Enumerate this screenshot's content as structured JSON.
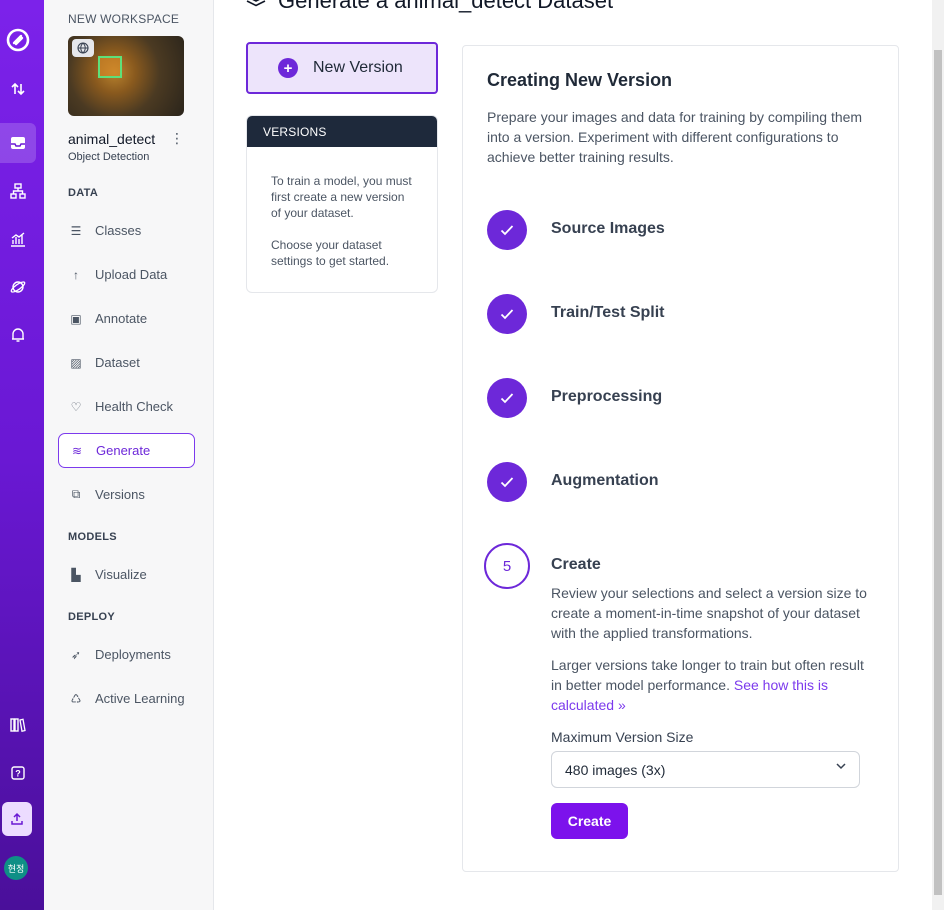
{
  "rail": {
    "icons": [
      "logo-icon",
      "swap-icon",
      "inbox-icon",
      "hierarchy-icon",
      "analytics-icon",
      "planet-icon",
      "bell-icon",
      "books-icon",
      "help-icon",
      "upload-icon"
    ],
    "avatar_text": "현정"
  },
  "sidebar": {
    "workspace_label": "NEW WORKSPACE",
    "project_name": "animal_detect",
    "project_type": "Object Detection",
    "sections": {
      "data": "DATA",
      "models": "MODELS",
      "deploy": "DEPLOY"
    },
    "items": {
      "classes": "Classes",
      "upload": "Upload Data",
      "annotate": "Annotate",
      "dataset": "Dataset",
      "health": "Health Check",
      "generate": "Generate",
      "versions": "Versions",
      "visualize": "Visualize",
      "deployments": "Deployments",
      "active_learning": "Active Learning"
    }
  },
  "header": {
    "title": "Generate a animal_detect Dataset"
  },
  "left_panel": {
    "new_version_label": "New Version",
    "versions_header": "VERSIONS",
    "versions_text_1": "To train a model, you must first create a new version of your dataset.",
    "versions_text_2": "Choose your dataset settings to get started."
  },
  "card": {
    "title": "Creating New Version",
    "description": "Prepare your images and data for training by compiling them into a version. Experiment with different configurations to achieve better training results.",
    "steps": {
      "s1": "Source Images",
      "s2": "Train/Test Split",
      "s3": "Preprocessing",
      "s4": "Augmentation",
      "s5": "Create",
      "s5_number": "5"
    },
    "create_text_1": "Review your selections and select a version size to create a moment-in-time snapshot of your dataset with the applied transformations.",
    "create_text_2": "Larger versions take longer to train but often result in better model performance.",
    "see_how_link": "See how this is calculated",
    "size_label": "Maximum Version Size",
    "size_value": "480 images (3x)",
    "create_button": "Create"
  },
  "colors": {
    "accent": "#6d28d9",
    "rail_top": "#7c22ea",
    "rail_bottom": "#4a0f9a",
    "create_button": "#7c12ec"
  }
}
